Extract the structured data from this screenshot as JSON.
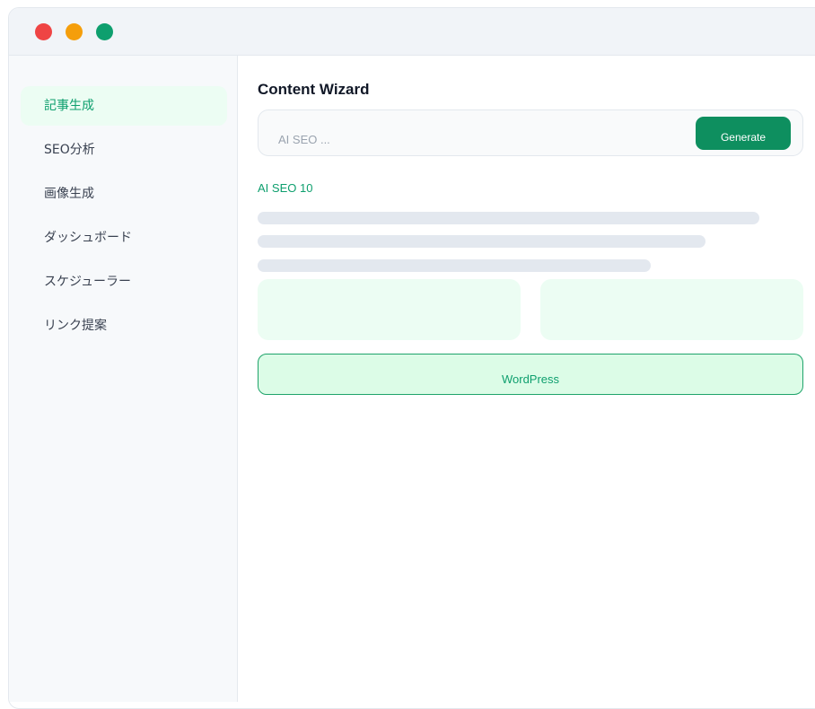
{
  "window": {
    "controls": [
      "close",
      "minimize",
      "maximize"
    ]
  },
  "sidebar": {
    "items": [
      {
        "label": "記事生成",
        "active": true
      },
      {
        "label": "SEO分析",
        "active": false
      },
      {
        "label": "画像生成",
        "active": false
      },
      {
        "label": "ダッシュボード",
        "active": false
      },
      {
        "label": "スケジューラー",
        "active": false
      },
      {
        "label": "リンク提案",
        "active": false
      }
    ]
  },
  "main": {
    "title": "Content Wizard",
    "input": {
      "value": "AI SEO ...",
      "generate_label": "Generate"
    },
    "status": "AI SEO 10",
    "publish_label": "WordPress"
  },
  "colors": {
    "accent": "#0e9f6e",
    "button": "#0e8f5f",
    "active_bg": "#ecfdf3",
    "close": "#ef4444",
    "minimize": "#f59e0b",
    "maximize": "#0e9f6e"
  }
}
